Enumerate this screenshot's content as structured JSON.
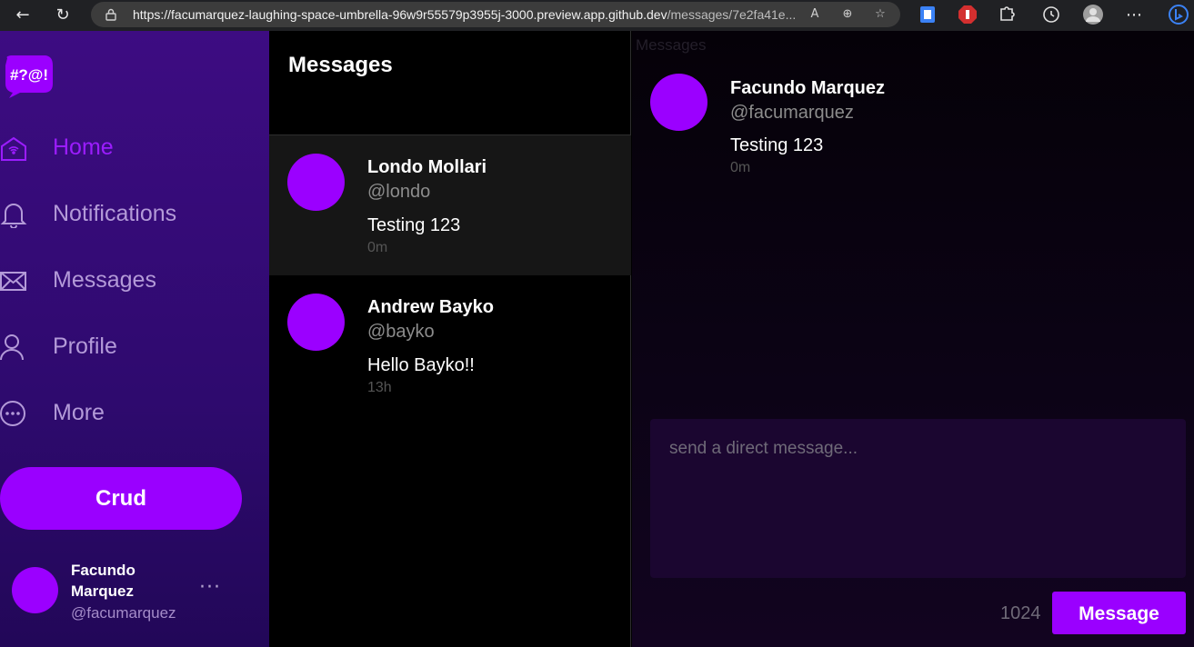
{
  "browser": {
    "url_host": "https://facumarquez-laughing-space-umbrella-96w9r55579p3955j-3000.preview.app.github.dev",
    "url_path": "/messages/7e2fa41e..."
  },
  "app": {
    "logo_text": "#?@!"
  },
  "sidebar": {
    "items": [
      {
        "label": "Home",
        "icon": "home-icon",
        "active": true
      },
      {
        "label": "Notifications",
        "icon": "bell-icon",
        "active": false
      },
      {
        "label": "Messages",
        "icon": "envelope-icon",
        "active": false
      },
      {
        "label": "Profile",
        "icon": "user-icon",
        "active": false
      },
      {
        "label": "More",
        "icon": "more-circle-icon",
        "active": false
      }
    ],
    "crud_button": "Crud",
    "current_user": {
      "name": "Facundo Marquez",
      "handle": "@facumarquez"
    }
  },
  "list": {
    "title": "Messages",
    "conversations": [
      {
        "name": "Londo Mollari",
        "handle": "@londo",
        "text": "Testing 123",
        "time": "0m"
      },
      {
        "name": "Andrew Bayko",
        "handle": "@bayko",
        "text": "Hello Bayko!!",
        "time": "13h"
      }
    ]
  },
  "thread": {
    "label": "Messages",
    "message": {
      "name": "Facundo Marquez",
      "handle": "@facumarquez",
      "text": "Testing 123",
      "time": "0m"
    },
    "composer_placeholder": "send a direct message...",
    "char_count": "1024",
    "send_label": "Message"
  },
  "colors": {
    "accent": "#9a00ff",
    "sidebar_bg": "#3d0c82"
  }
}
